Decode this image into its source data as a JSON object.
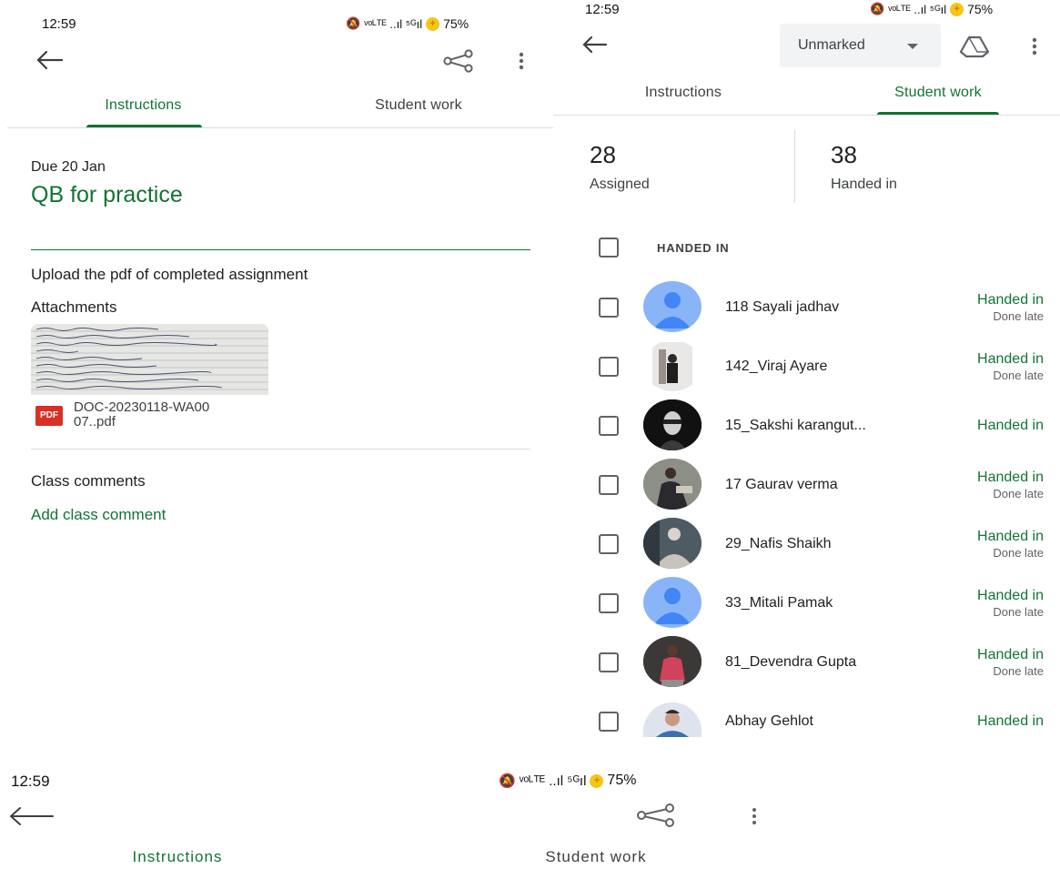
{
  "colors": {
    "accent": "#137333",
    "avatar_default": "#8ab4f8",
    "pdf_red": "#d93025"
  },
  "screen1": {
    "status": {
      "time": "12:59",
      "icons_text": "ᵛᵒᴸᵀᴱ ..ıl ⁵ᴳıl",
      "battery": "75%"
    },
    "toolbar": {
      "back_icon": "arrow-back-icon",
      "share_icon": "share-icon",
      "more_icon": "more-vert-icon"
    },
    "tabs": {
      "instructions": "Instructions",
      "student_work": "Student work",
      "active": "instructions"
    },
    "due": "Due 20 Jan",
    "title": "QB for practice",
    "description": "Upload the pdf of completed assignment",
    "attachments_heading": "Attachments",
    "attachment": {
      "badge": "PDF",
      "name_line1": "DOC-20230118-WA00",
      "name_line2": "07..pdf"
    },
    "comments_heading": "Class comments",
    "add_comment": "Add class comment"
  },
  "screen2": {
    "status": {
      "time": "12:59",
      "icons_text": "ᵛᵒᴸᵀᴱ ..ıl ⁵ᴳıl",
      "battery": "75%"
    },
    "toolbar": {
      "filter_label": "Unmarked",
      "drive_icon": "drive-icon",
      "more_icon": "more-vert-icon"
    },
    "tabs": {
      "instructions": "Instructions",
      "student_work": "Student work",
      "active": "student_work"
    },
    "stats": [
      {
        "count": "28",
        "label": "Assigned"
      },
      {
        "count": "38",
        "label": "Handed in"
      }
    ],
    "section_header": "HANDED IN",
    "students": [
      {
        "name": "118 Sayali jadhav",
        "status": "Handed in",
        "late": "Done late",
        "avatar": "default"
      },
      {
        "name": "142_Viraj Ayare",
        "status": "Handed in",
        "late": "Done late",
        "avatar": "photo-light"
      },
      {
        "name": "15_Sakshi karangut...",
        "status": "Handed in",
        "late": "",
        "avatar": "photo-dark"
      },
      {
        "name": "17 Gaurav verma",
        "status": "Handed in",
        "late": "Done late",
        "avatar": "photo-mid"
      },
      {
        "name": "29_Nafis Shaikh",
        "status": "Handed in",
        "late": "Done late",
        "avatar": "photo-mid"
      },
      {
        "name": "33_Mitali Pamak",
        "status": "Handed in",
        "late": "Done late",
        "avatar": "default"
      },
      {
        "name": "81_Devendra Gupta",
        "status": "Handed in",
        "late": "Done late",
        "avatar": "photo-red"
      },
      {
        "name": "Abhay Gehlot",
        "status": "Handed in",
        "late": "",
        "avatar": "photo-blue"
      }
    ]
  },
  "screen3": {
    "status": {
      "time": "12:59",
      "icons_text": "ᵛᵒᴸᵀᴱ ..ıl ⁵ᴳıl",
      "battery": "75%"
    },
    "tabs": {
      "instructions": "Instructions",
      "student_work": "Student work"
    }
  }
}
